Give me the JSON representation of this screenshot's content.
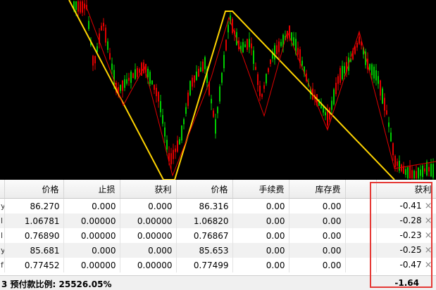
{
  "colors": {
    "up": "#00cc00",
    "down": "#e00000",
    "zigzag": "#ffd400",
    "thin": "#e00000",
    "highlight": "#e53935"
  },
  "table": {
    "headers": {
      "price_open": "价格",
      "stop_loss": "止损",
      "take_profit": "获利",
      "price_current": "价格",
      "commission": "手续费",
      "swap": "库存费",
      "profit": "获利"
    },
    "rows": [
      {
        "sym": "y",
        "price_open": "86.270",
        "sl": "0.000",
        "tp": "0.000",
        "price": "86.316",
        "commission": "0.00",
        "swap": "0.00",
        "profit": "-0.41"
      },
      {
        "sym": "l",
        "price_open": "1.06781",
        "sl": "0.00000",
        "tp": "0.00000",
        "price": "1.06820",
        "commission": "0.00",
        "swap": "0.00",
        "profit": "-0.28"
      },
      {
        "sym": "l",
        "price_open": "0.76890",
        "sl": "0.00000",
        "tp": "0.00000",
        "price": "0.76867",
        "commission": "0.00",
        "swap": "0.00",
        "profit": "-0.23"
      },
      {
        "sym": "y",
        "price_open": "85.681",
        "sl": "0.000",
        "tp": "0.000",
        "price": "85.653",
        "commission": "0.00",
        "swap": "0.00",
        "profit": "-0.25"
      },
      {
        "sym": "f",
        "price_open": "0.77452",
        "sl": "0.00000",
        "tp": "0.00000",
        "price": "0.77499",
        "commission": "0.00",
        "swap": "0.00",
        "profit": "-0.47"
      }
    ],
    "close_glyph": "×"
  },
  "footer": {
    "left_text": "3  预付款比例: 25526.05%",
    "total_profit": "-1.64"
  }
}
